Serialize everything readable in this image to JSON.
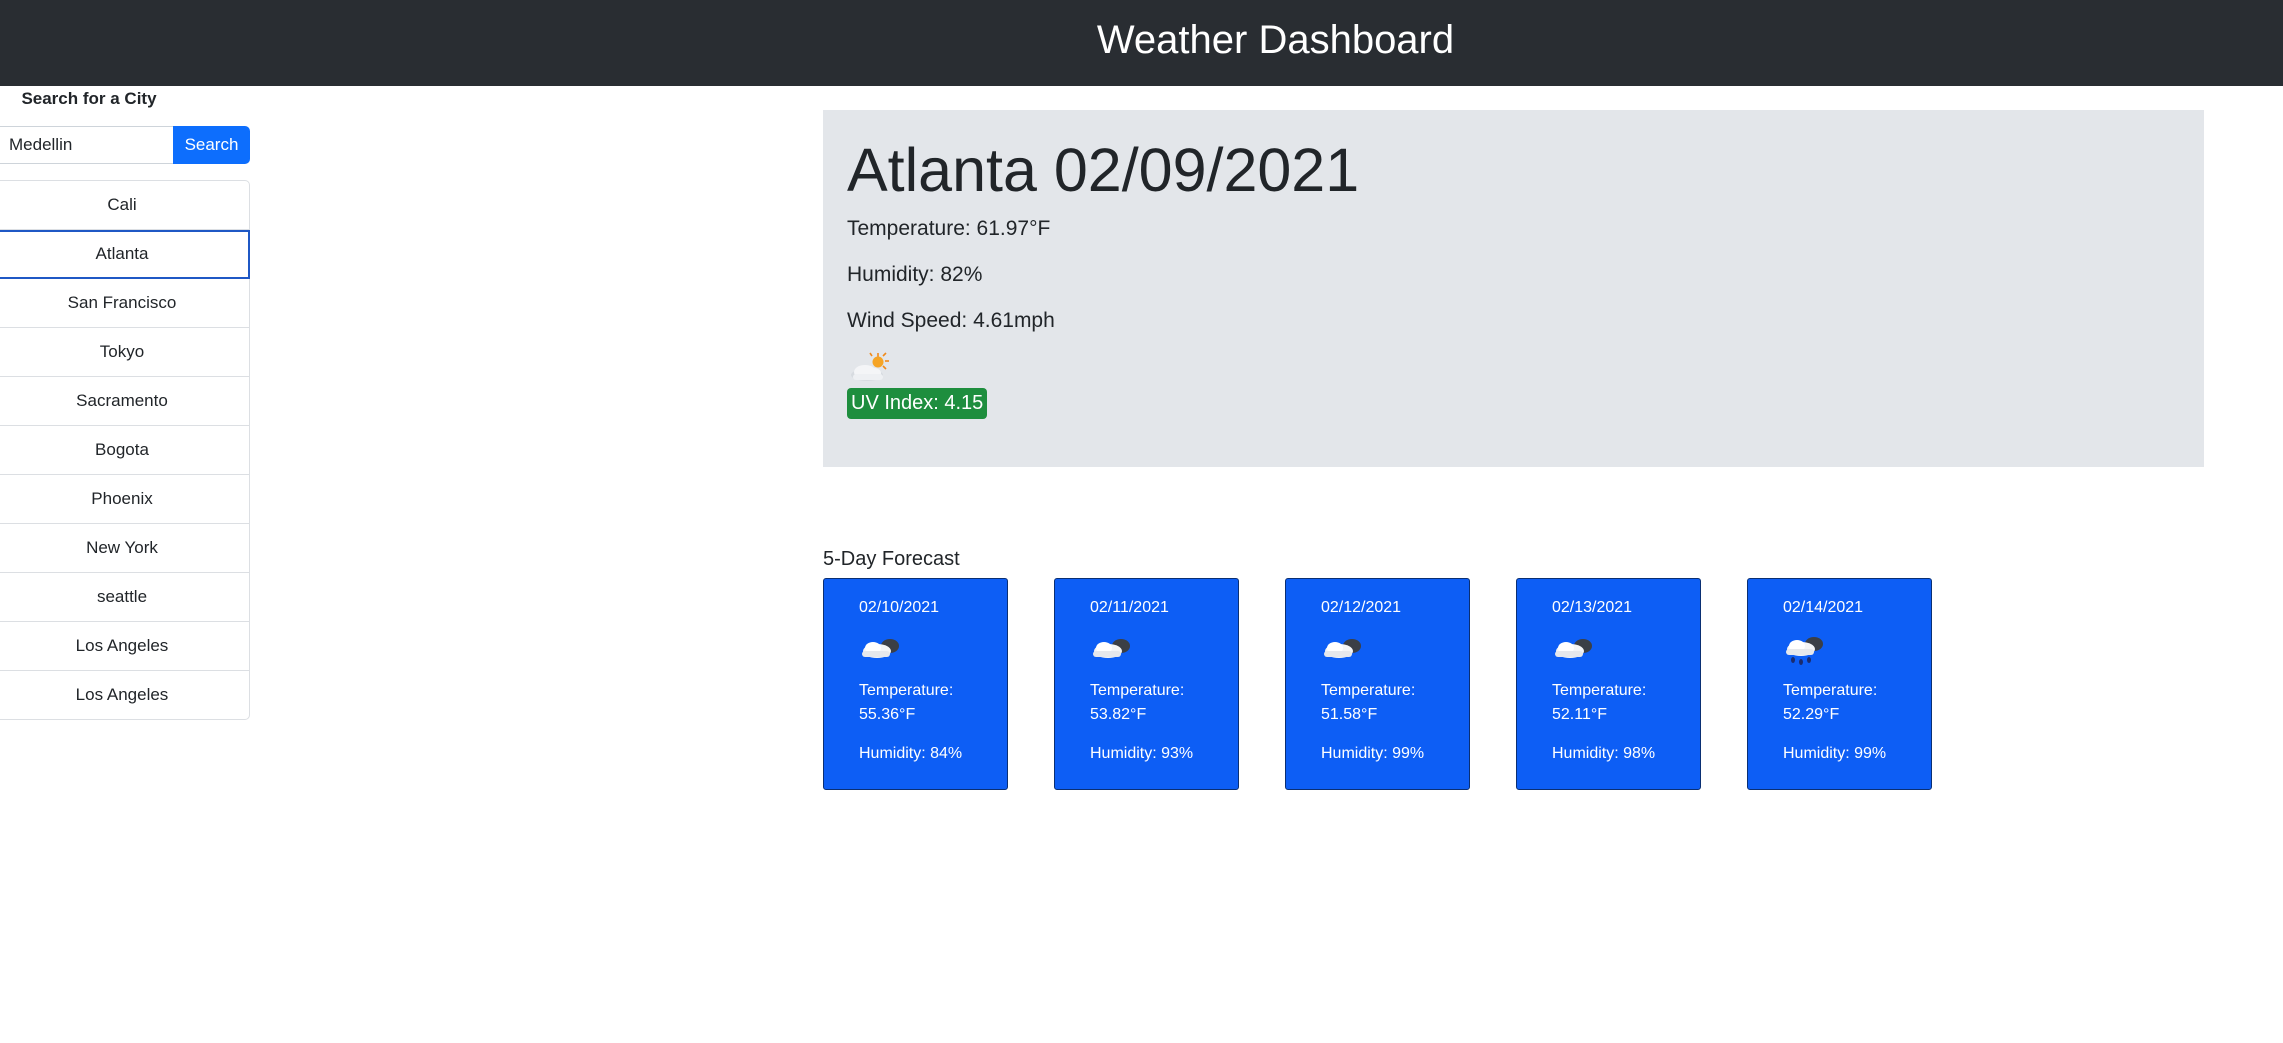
{
  "header": {
    "title": "Weather Dashboard"
  },
  "sidebar": {
    "heading": "Search for a City",
    "search": {
      "value": "Medellin",
      "button_label": "Search"
    },
    "cities": [
      "Cali",
      "Atlanta",
      "San Francisco",
      "Tokyo",
      "Sacramento",
      "Bogota",
      "Phoenix",
      "New York",
      "seattle",
      "Los Angeles",
      "Los Angeles"
    ],
    "active_city": "Atlanta"
  },
  "current": {
    "title": "Atlanta 02/09/2021",
    "temperature": "Temperature: 61.97°F",
    "humidity": "Humidity: 82%",
    "wind": "Wind Speed: 4.61mph",
    "icon": "partly-cloudy-day-icon",
    "uv": "UV Index: 4.15",
    "uv_color": "#1e8e3e"
  },
  "forecast": {
    "heading": "5-Day Forecast",
    "days": [
      {
        "date": "02/10/2021",
        "icon": "partly-cloudy-night-icon",
        "temp": "Temperature: 55.36°F",
        "humidity": "Humidity: 84%"
      },
      {
        "date": "02/11/2021",
        "icon": "partly-cloudy-night-icon",
        "temp": "Temperature: 53.82°F",
        "humidity": "Humidity: 93%"
      },
      {
        "date": "02/12/2021",
        "icon": "partly-cloudy-night-icon",
        "temp": "Temperature: 51.58°F",
        "humidity": "Humidity: 99%"
      },
      {
        "date": "02/13/2021",
        "icon": "partly-cloudy-night-icon",
        "temp": "Temperature: 52.11°F",
        "humidity": "Humidity: 98%"
      },
      {
        "date": "02/14/2021",
        "icon": "rain-cloud-icon",
        "temp": "Temperature: 52.29°F",
        "humidity": "Humidity: 99%"
      }
    ]
  },
  "colors": {
    "header_bg": "#292d32",
    "primary": "#0d6efd",
    "panel_bg": "#e3e6ea"
  }
}
